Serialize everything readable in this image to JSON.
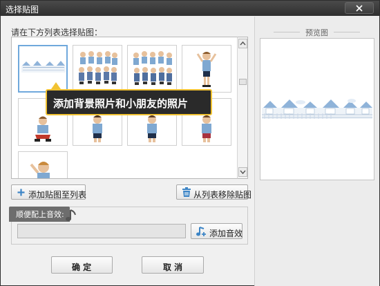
{
  "window": {
    "title": "选择贴图"
  },
  "list": {
    "prompt": "请在下方列表选择贴图：",
    "items": [
      {
        "kind": "town-border",
        "selected": true
      },
      {
        "kind": "group-of-children"
      },
      {
        "kind": "group-of-children"
      },
      {
        "kind": "child-waving"
      },
      {
        "kind": "children-sitting"
      },
      {
        "kind": "child-standing"
      },
      {
        "kind": "child-standing"
      },
      {
        "kind": "child-standing"
      },
      {
        "kind": "child-waving"
      }
    ]
  },
  "tooltip": {
    "text": "添加背景照片和小朋友的照片"
  },
  "actions": {
    "add_label": "添加贴图至列表",
    "remove_label": "从列表移除贴图"
  },
  "audio": {
    "section_label": "顺便配上音效:",
    "field_value": "",
    "add_label": "添加音效"
  },
  "preview": {
    "title": "预览图"
  },
  "footer": {
    "ok_label": "确 定",
    "cancel_label": "取 消"
  },
  "colors": {
    "accent": "#f1c232",
    "selection": "#6fa8dc",
    "plus": "#3d85c6"
  }
}
